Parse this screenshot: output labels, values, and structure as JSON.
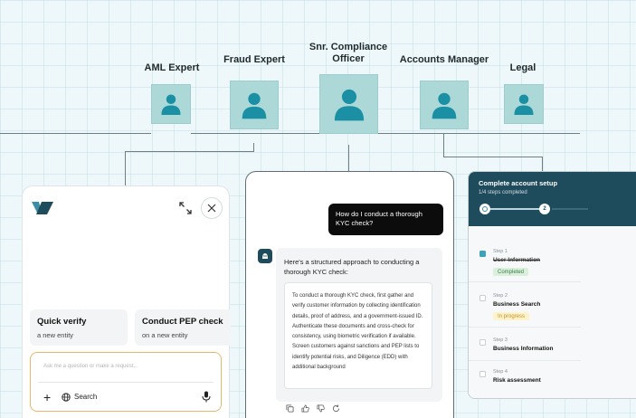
{
  "personas": [
    {
      "label": "AML Expert"
    },
    {
      "label": "Fraud Expert"
    },
    {
      "label": "Snr. Compliance\nOfficer"
    },
    {
      "label": "Accounts Manager"
    },
    {
      "label": "Legal"
    }
  ],
  "widget": {
    "quick_actions": [
      {
        "title": "Quick verify",
        "subtitle": "a new entity"
      },
      {
        "title": "Conduct PEP check",
        "subtitle": "on a new entity"
      }
    ],
    "input_placeholder": "Ask me a question or make a request...",
    "search_label": "Search"
  },
  "conversation": {
    "user_message": "How do I conduct a thorough KYC check?",
    "bot_intro": "Here's a structured approach to conducting a thorough KYC check:",
    "bot_details": "To conduct a thorough KYC check, first gather and verify customer information by collecting identification details, proof of address, and a government-issued ID. Authenticate these documents and cross-check for consistency, using biometric verification if available. Screen customers against sanctions and PEP lists to identify potential risks, and  Diligence (EDD) with additional background"
  },
  "setup": {
    "title": "Complete account setup",
    "subtitle": "1/4 steps completed",
    "progress_current": "2",
    "steps": [
      {
        "step": "Step 1",
        "title": "User Information",
        "status": "Completed"
      },
      {
        "step": "Step 2",
        "title": "Business Search",
        "status": "In progress"
      },
      {
        "step": "Step 3",
        "title": "Business Information",
        "status": ""
      },
      {
        "step": "Step 4",
        "title": "Risk assessment",
        "status": ""
      }
    ]
  },
  "colors": {
    "background": "#eef7f9",
    "avatar": "#acd9d8",
    "avatar_figure": "#1b8fa3",
    "dark_teal": "#1f4c5d",
    "input_border": "#e9b66b"
  },
  "icons": [
    "logo-icon",
    "expand-icon",
    "close-icon",
    "plus-icon",
    "globe-icon",
    "mic-icon",
    "bot-icon",
    "copy-icon",
    "thumbs-up-icon",
    "thumbs-down-icon",
    "regenerate-icon",
    "check-icon"
  ]
}
